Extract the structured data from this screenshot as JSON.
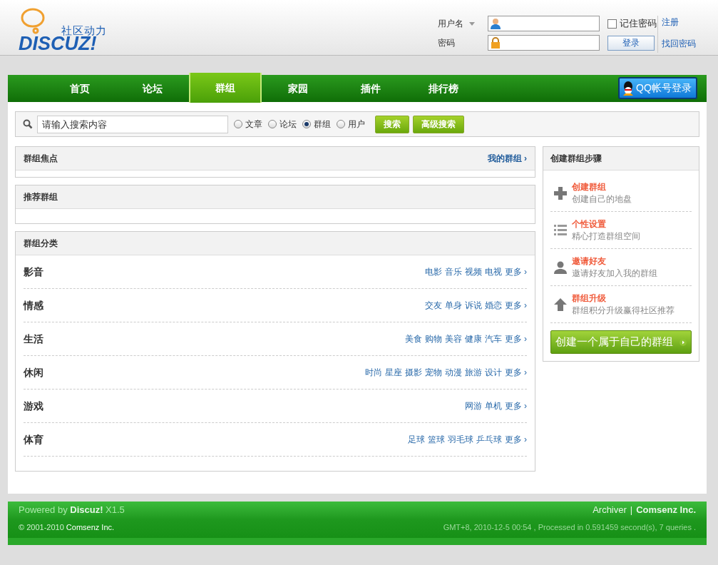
{
  "logo": {
    "tagline": "社区动力",
    "wordmark": "DISCUZ!"
  },
  "login": {
    "username_label": "用户名",
    "password_label": "密码",
    "remember": {
      "label": "记住密码",
      "checked": false
    },
    "button": "登录",
    "links": [
      "注册",
      "找回密码"
    ]
  },
  "nav": {
    "items": [
      {
        "label": "首页",
        "selected": false
      },
      {
        "label": "论坛",
        "selected": false
      },
      {
        "label": "群组",
        "selected": true
      },
      {
        "label": "家园",
        "selected": false
      },
      {
        "label": "插件",
        "selected": false
      },
      {
        "label": "排行榜",
        "selected": false
      }
    ],
    "qq_login": "QQ帐号登录"
  },
  "search": {
    "placeholder": "请输入搜索内容",
    "options": [
      {
        "label": "文章",
        "selected": false
      },
      {
        "label": "论坛",
        "selected": false
      },
      {
        "label": "群组",
        "selected": true
      },
      {
        "label": "用户",
        "selected": false
      }
    ],
    "buttons": [
      "搜索",
      "高级搜索"
    ]
  },
  "focus_panel": {
    "title": "群组焦点",
    "link": "我的群组",
    "arrow": "›"
  },
  "recommend_panel": {
    "title": "推荐群组"
  },
  "categories": {
    "title": "群组分类",
    "rows": [
      {
        "name": "影音",
        "tags": [
          "电影",
          "音乐",
          "视频",
          "电视"
        ],
        "more": "更多 ›"
      },
      {
        "name": "情感",
        "tags": [
          "交友",
          "单身",
          "诉说",
          "婚恋"
        ],
        "more": "更多 ›"
      },
      {
        "name": "生活",
        "tags": [
          "美食",
          "购物",
          "美容",
          "健康",
          "汽车"
        ],
        "more": "更多 ›"
      },
      {
        "name": "休闲",
        "tags": [
          "时尚",
          "星座",
          "摄影",
          "宠物",
          "动漫",
          "旅游",
          "设计"
        ],
        "more": "更多 ›"
      },
      {
        "name": "游戏",
        "tags": [
          "网游",
          "单机"
        ],
        "more": "更多 ›"
      },
      {
        "name": "体育",
        "tags": [
          "足球",
          "篮球",
          "羽毛球",
          "乒乓球"
        ],
        "more": "更多 ›"
      }
    ]
  },
  "sidebar": {
    "title": "创建群组步骤",
    "steps": [
      {
        "kind": "create",
        "title": "创建群组",
        "desc": "创建自己的地盘"
      },
      {
        "kind": "settings",
        "title": "个性设置",
        "desc": "精心打造群组空间"
      },
      {
        "kind": "invite",
        "title": "邀请好友",
        "desc": "邀请好友加入我的群组"
      },
      {
        "kind": "upgrade",
        "title": "群组升级",
        "desc": "群组积分升级赢得社区推荐"
      }
    ],
    "button": "创建一个属于自己的群组"
  },
  "footer": {
    "powered": "Powered by **Discuz!** X1.5",
    "copyright": "© 2001-2010 **Comsenz Inc.**",
    "links": [
      "Archiver",
      "Comsenz Inc."
    ],
    "separator": "|",
    "stats": "GMT+8, 2010-12-5 00:54 , Processed in 0.591459 second(s), 7 queries ."
  }
}
